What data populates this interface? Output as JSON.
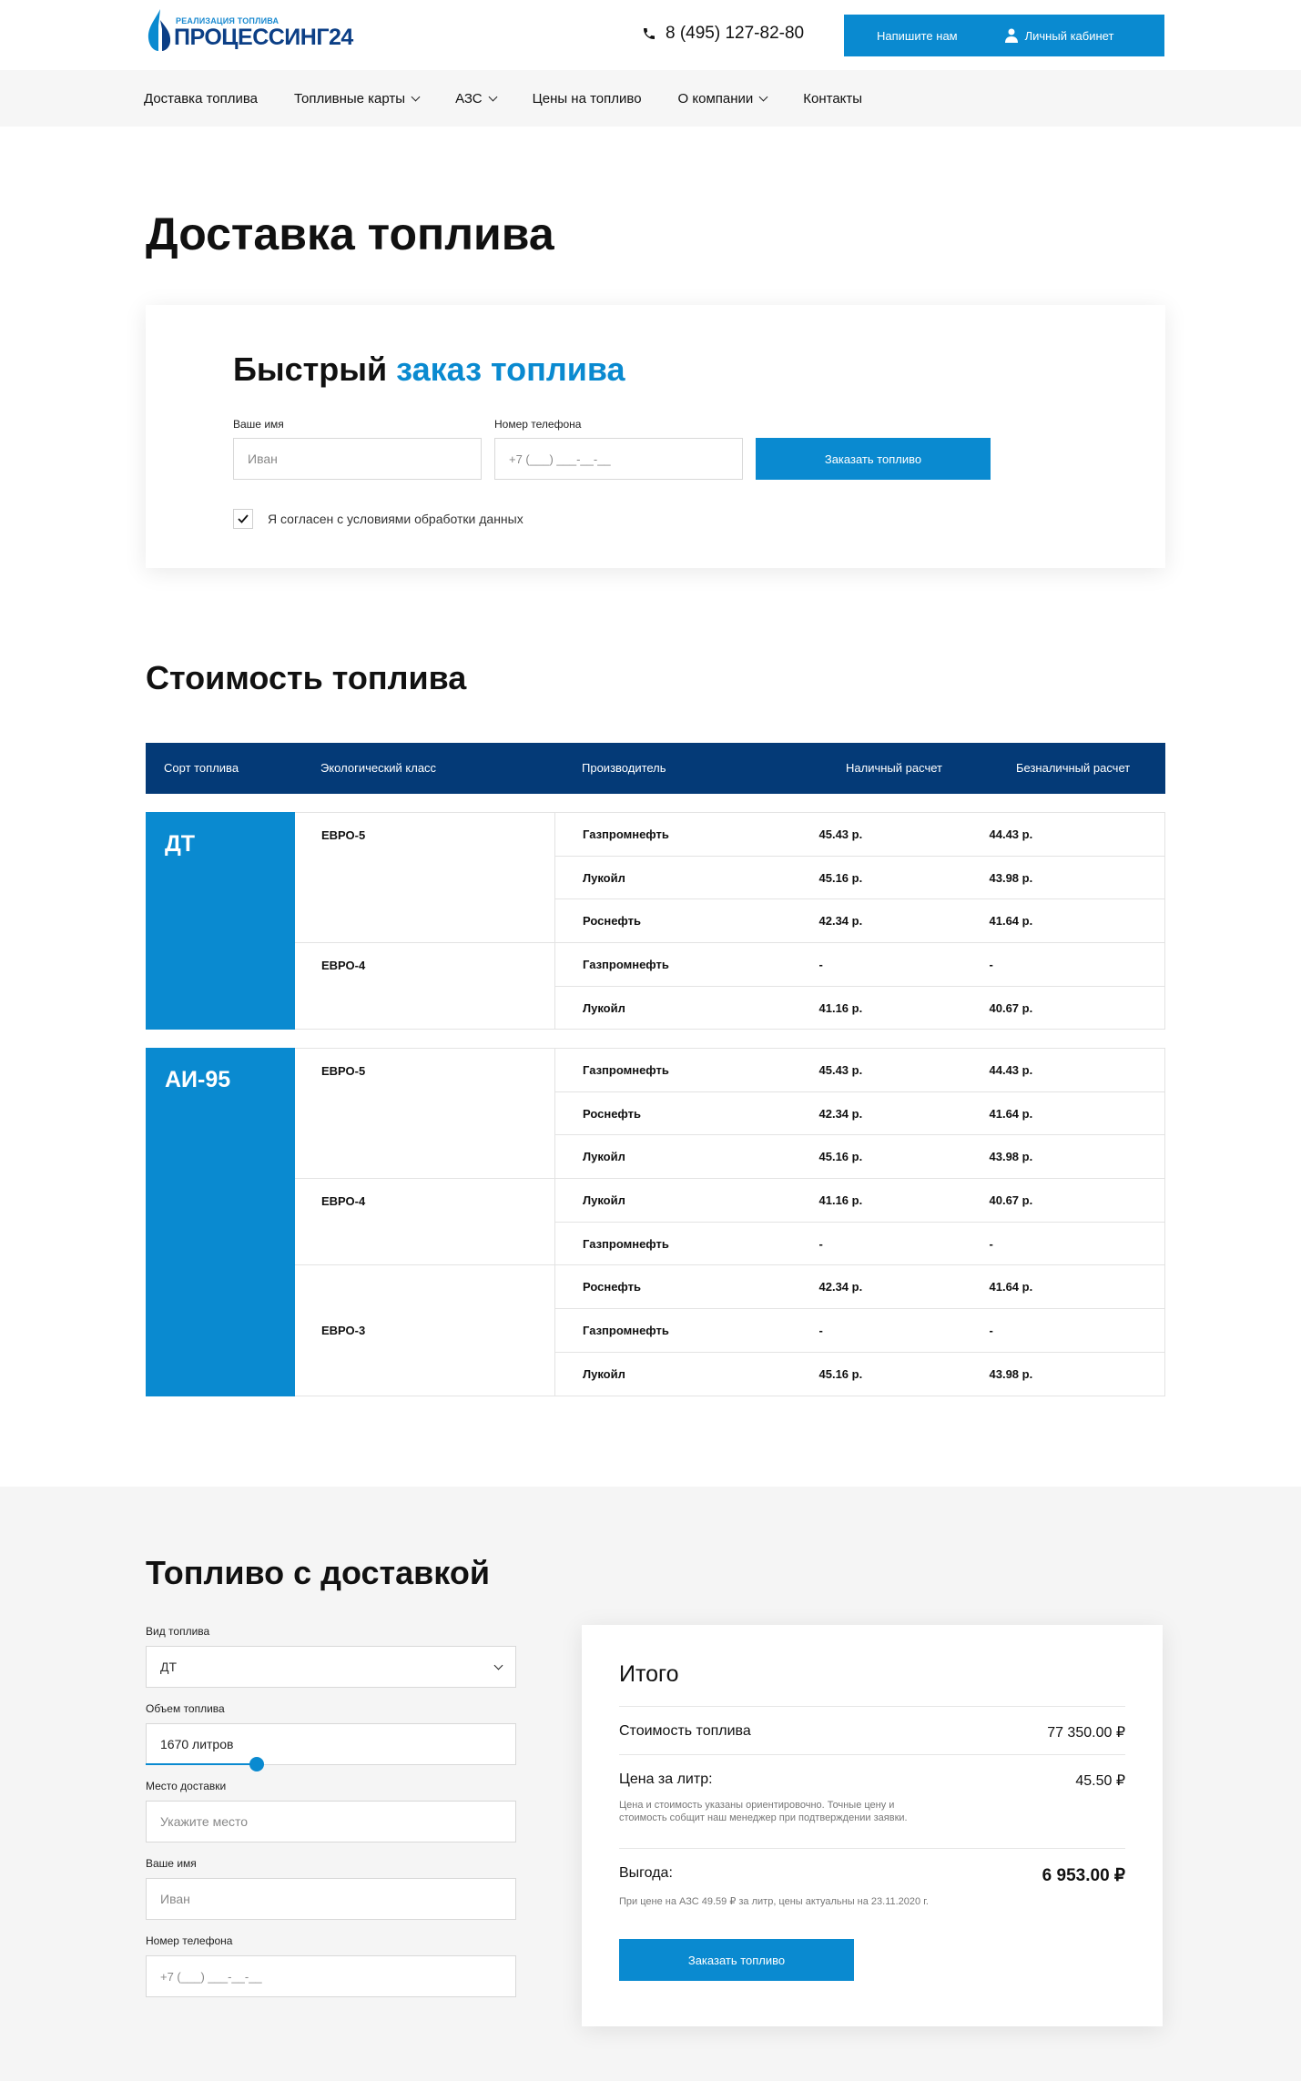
{
  "header": {
    "logo_small": "РЕАЛИЗАЦИЯ ТОПЛИВА",
    "logo_big": "ПРОЦЕССИНГ24",
    "phone": "8 (495) 127-82-80",
    "write_us": "Напишите нам",
    "cabinet": "Личный кабинет"
  },
  "nav": [
    "Доставка топлива",
    "Топливные карты",
    "АЗС",
    "Цены на топливо",
    "О компании",
    "Контакты"
  ],
  "page_title": "Доставка топлива",
  "quick_order": {
    "title_a": "Быстрый",
    "title_b": "заказ топлива",
    "name_label": "Ваше имя",
    "name_placeholder": "Иван",
    "phone_label": "Номер телефона",
    "phone_placeholder": "+7 (___) ___-__-__",
    "submit": "Заказать топливо",
    "consent": "Я согласен с условиями обработки данных",
    "consent_checked": true
  },
  "prices": {
    "title": "Стоимость топлива",
    "headers": [
      "Сорт топлива",
      "Экологический класс",
      "Производитель",
      "Наличный расчет",
      "Безналичный расчет"
    ],
    "groups": [
      {
        "sort": "ДТ",
        "classes": [
          {
            "name": "ЕВРО-5",
            "rows": [
              [
                "Газпромнефть",
                "45.43 р.",
                "44.43 р."
              ],
              [
                "Лукойл",
                "45.16 р.",
                "43.98 р."
              ],
              [
                "Роснефть",
                "42.34 р.",
                "41.64 р."
              ]
            ]
          },
          {
            "name": "ЕВРО-4",
            "rows": [
              [
                "Газпромнефть",
                "-",
                "-"
              ],
              [
                "Лукойл",
                "41.16 р.",
                "40.67 р."
              ]
            ]
          }
        ]
      },
      {
        "sort": "АИ-95",
        "classes": [
          {
            "name": "ЕВРО-5",
            "rows": [
              [
                "Газпромнефть",
                "45.43 р.",
                "44.43 р."
              ],
              [
                "Роснефть",
                "42.34 р.",
                "41.64 р."
              ],
              [
                "Лукойл",
                "45.16 р.",
                "43.98 р."
              ]
            ]
          },
          {
            "name": "ЕВРО-4",
            "rows": [
              [
                "Лукойл",
                "41.16 р.",
                "40.67 р."
              ],
              [
                "Газпромнефть",
                "-",
                "-"
              ]
            ]
          },
          {
            "name": "ЕВРО-3",
            "rows": [
              [
                "Роснефть",
                "42.34 р.",
                "41.64 р."
              ],
              [
                "Газпромнефть",
                "-",
                "-"
              ],
              [
                "Лукойл",
                "45.16 р.",
                "43.98 р."
              ]
            ]
          }
        ]
      }
    ]
  },
  "delivery": {
    "title": "Топливо с доставкой",
    "fuel_label": "Вид топлива",
    "fuel_value": "ДТ",
    "volume_label": "Объем топлива",
    "volume_value": "1670 литров",
    "volume_slider_fraction": 0.3,
    "place_label": "Место доставки",
    "place_placeholder": "Укажите место",
    "name_label": "Ваше имя",
    "name_placeholder": "Иван",
    "phone_label": "Номер телефона",
    "phone_placeholder": "+7 (___) ___-__-__"
  },
  "summary": {
    "title": "Итого",
    "cost_label": "Стоимость топлива",
    "cost_value": "77 350.00 ₽",
    "price_label": "Цена за литр:",
    "price_value": "45.50 ₽",
    "price_note": "Цена и стоимость указаны ориентировочно. Точные цену и стоимость собщит наш менеджер при подтверждении заявки.",
    "benefit_label": "Выгода:",
    "benefit_value": "6 953.00 ₽",
    "benefit_note": "При цене на АЗС  49.59 ₽  за литр, цены актуальны на 23.11.2020 г.",
    "submit": "Заказать топливо"
  }
}
